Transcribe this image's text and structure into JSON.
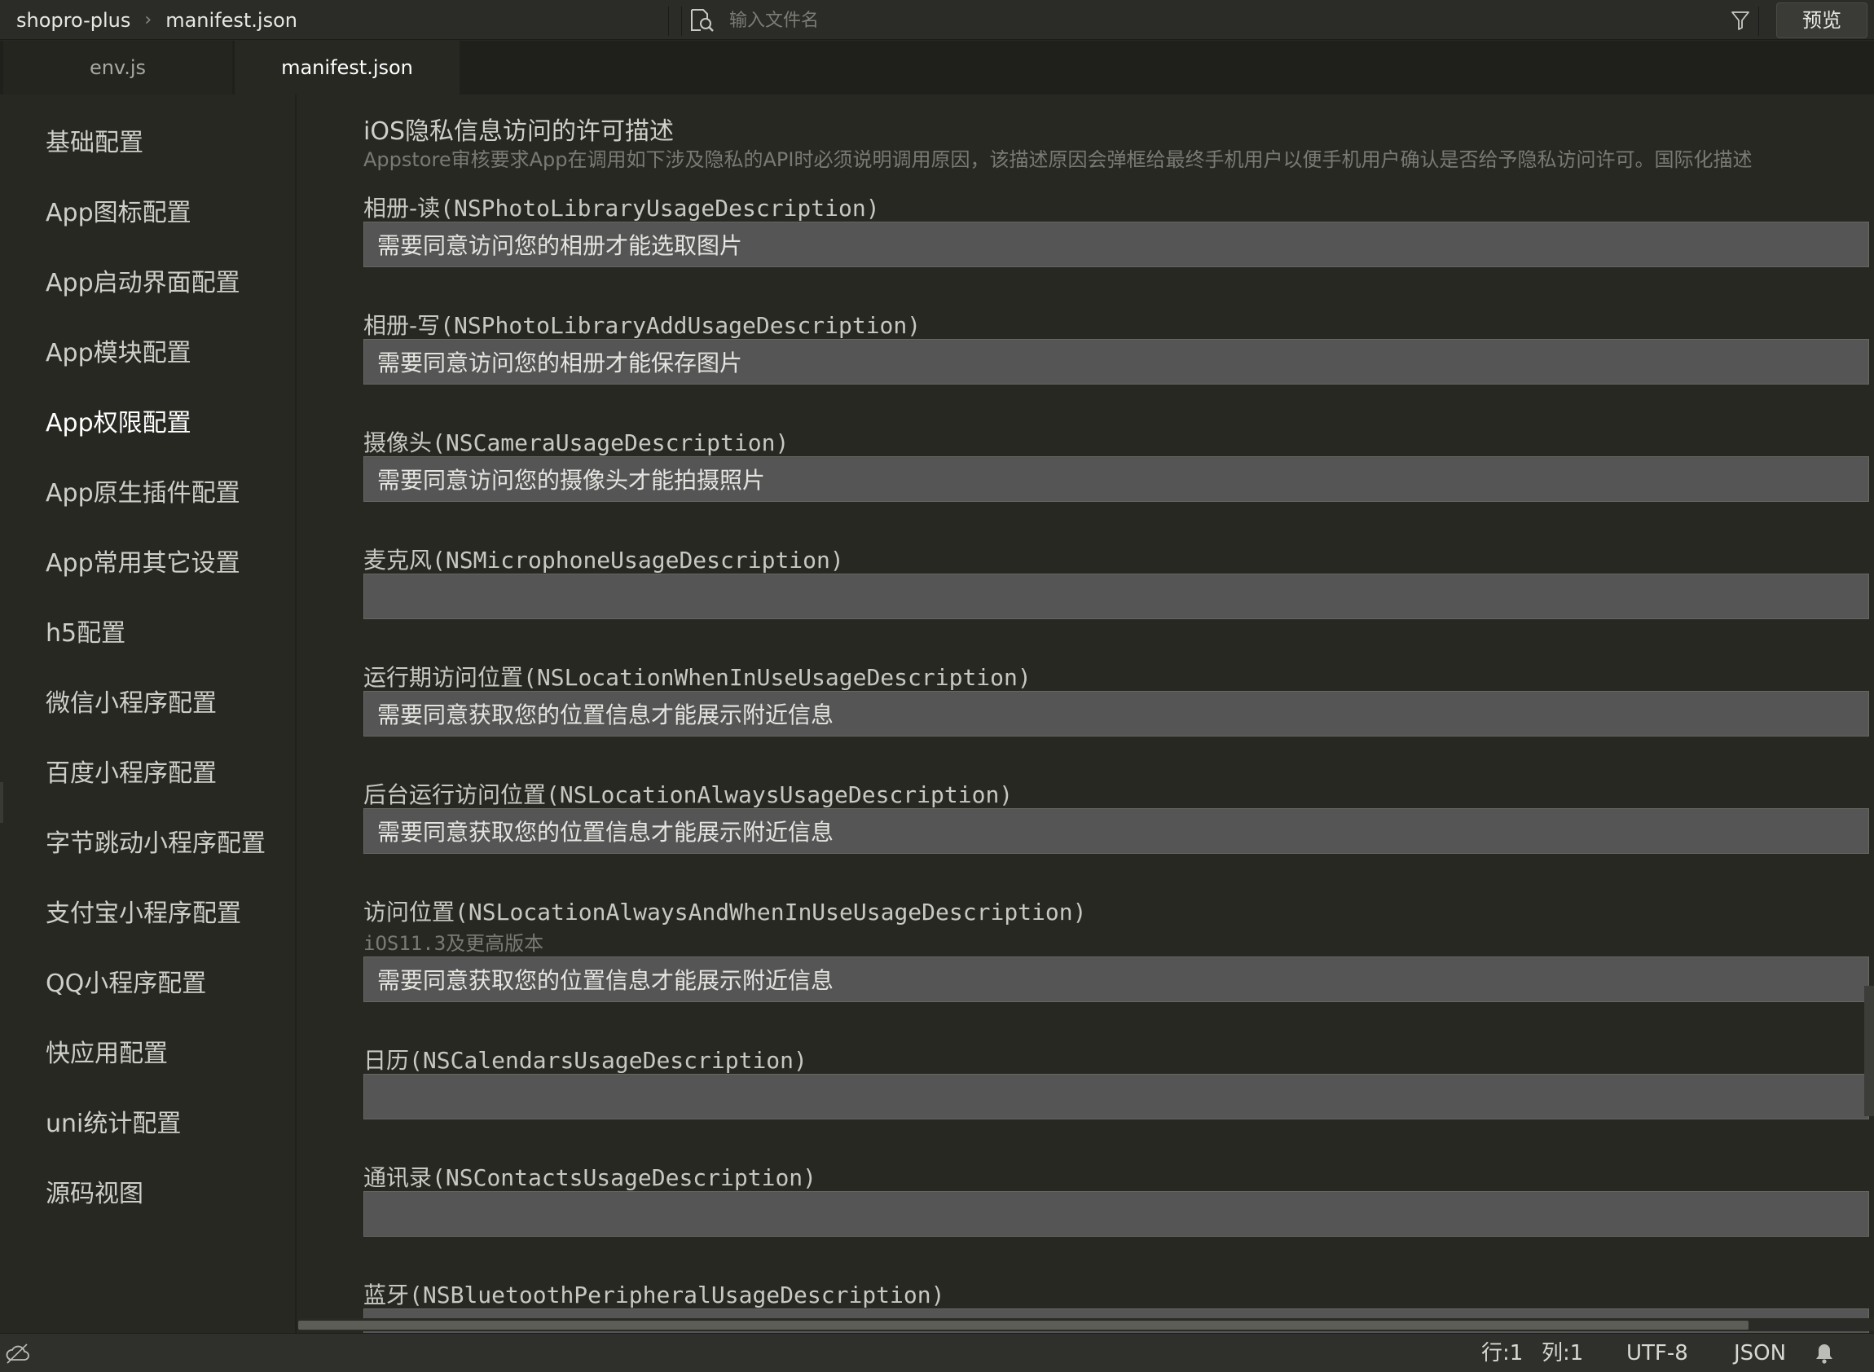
{
  "breadcrumb": {
    "project": "shopro-plus",
    "separator": "›",
    "file": "manifest.json"
  },
  "search": {
    "placeholder": "输入文件名"
  },
  "toolbar": {
    "preview_label": "预览"
  },
  "tabs": [
    {
      "label": "env.js"
    },
    {
      "label": "manifest.json",
      "active": true
    }
  ],
  "sidebar": {
    "items": [
      {
        "label": "基础配置"
      },
      {
        "label": "App图标配置"
      },
      {
        "label": "App启动界面配置"
      },
      {
        "label": "App模块配置"
      },
      {
        "label": "App权限配置",
        "active": true
      },
      {
        "label": "App原生插件配置"
      },
      {
        "label": "App常用其它设置"
      },
      {
        "label": "h5配置"
      },
      {
        "label": "微信小程序配置"
      },
      {
        "label": "百度小程序配置"
      },
      {
        "label": "字节跳动小程序配置"
      },
      {
        "label": "支付宝小程序配置"
      },
      {
        "label": "QQ小程序配置"
      },
      {
        "label": "快应用配置"
      },
      {
        "label": "uni统计配置"
      },
      {
        "label": "源码视图"
      }
    ]
  },
  "section": {
    "title": "iOS隐私信息访问的许可描述",
    "description": "Appstore审核要求App在调用如下涉及隐私的API时必须说明调用原因，该描述原因会弹框给最终手机用户以便手机用户确认是否给予隐私访问许可。国际化描述"
  },
  "fields": [
    {
      "label_cn": "相册-读",
      "label_key": "(NSPhotoLibraryUsageDescription)",
      "value": "需要同意访问您的相册才能选取图片"
    },
    {
      "label_cn": "相册-写",
      "label_key": "(NSPhotoLibraryAddUsageDescription)",
      "value": "需要同意访问您的相册才能保存图片"
    },
    {
      "label_cn": "摄像头",
      "label_key": "(NSCameraUsageDescription)",
      "value": "需要同意访问您的摄像头才能拍摄照片"
    },
    {
      "label_cn": "麦克风",
      "label_key": "(NSMicrophoneUsageDescription)",
      "value": ""
    },
    {
      "label_cn": "运行期访问位置",
      "label_key": "(NSLocationWhenInUseUsageDescription)",
      "value": "需要同意获取您的位置信息才能展示附近信息"
    },
    {
      "label_cn": "后台运行访问位置",
      "label_key": "(NSLocationAlwaysUsageDescription)",
      "value": "需要同意获取您的位置信息才能展示附近信息"
    },
    {
      "label_cn": "访问位置",
      "label_key": "(NSLocationAlwaysAndWhenInUseUsageDescription)",
      "hint": "iOS11.3及更高版本",
      "value": "需要同意获取您的位置信息才能展示附近信息"
    },
    {
      "label_cn": "日历",
      "label_key": "(NSCalendarsUsageDescription)",
      "value": ""
    },
    {
      "label_cn": "通讯录",
      "label_key": "(NSContactsUsageDescription)",
      "value": ""
    },
    {
      "label_cn": "蓝牙",
      "label_key": "(NSBluetoothPeripheralUsageDescription)",
      "value": ""
    }
  ],
  "status": {
    "line": "行:1",
    "column": "列:1",
    "encoding": "UTF-8",
    "language": "JSON"
  },
  "icons": {
    "search": "file-search-icon",
    "filter": "filter-icon",
    "cloud": "cloud-icon",
    "bell": "bell-icon"
  }
}
